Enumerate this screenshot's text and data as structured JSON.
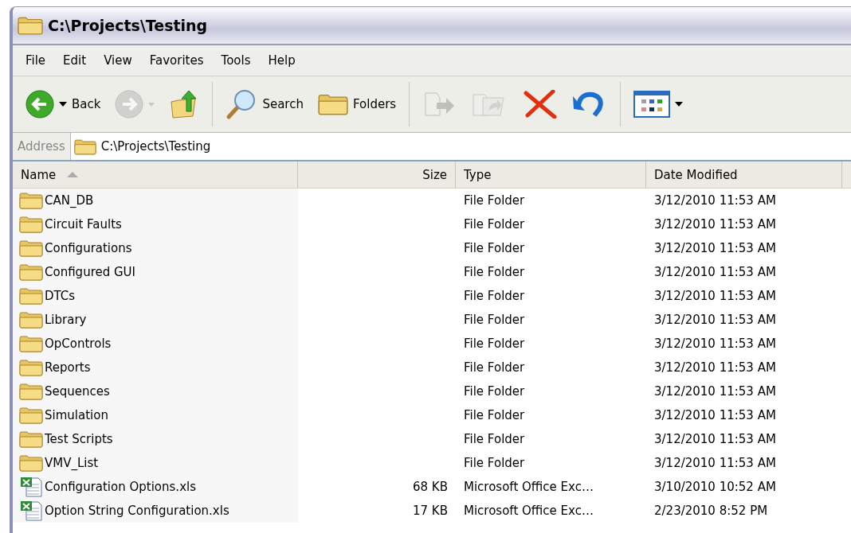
{
  "window": {
    "title": "C:\\Projects\\Testing"
  },
  "menu": [
    "File",
    "Edit",
    "View",
    "Favorites",
    "Tools",
    "Help"
  ],
  "toolbar": [
    {
      "kind": "back",
      "label": "Back",
      "disabled": false
    },
    {
      "kind": "forward",
      "disabled": true
    },
    {
      "kind": "up",
      "disabled": false
    },
    {
      "kind": "search",
      "label": "Search",
      "disabled": false
    },
    {
      "kind": "folders",
      "label": "Folders",
      "disabled": false
    },
    {
      "kind": "move",
      "disabled": true
    },
    {
      "kind": "copy",
      "disabled": true
    },
    {
      "kind": "delete",
      "disabled": false
    },
    {
      "kind": "undo",
      "disabled": false
    },
    {
      "kind": "views",
      "disabled": false
    }
  ],
  "address": {
    "label": "Address",
    "value": "C:\\Projects\\Testing"
  },
  "table": {
    "columns": [
      {
        "label": "Name",
        "sorted": true
      },
      {
        "label": "Size",
        "sorted": false
      },
      {
        "label": "Type",
        "sorted": false
      },
      {
        "label": "Date Modified",
        "sorted": false
      }
    ],
    "rows": [
      {
        "kind": "folder",
        "name": "CAN_DB",
        "type": "File Folder",
        "date": "3/12/2010 11:53 AM"
      },
      {
        "kind": "folder",
        "name": "Circuit Faults",
        "type": "File Folder",
        "date": "3/12/2010 11:53 AM"
      },
      {
        "kind": "folder",
        "name": "Configurations",
        "type": "File Folder",
        "date": "3/12/2010 11:53 AM"
      },
      {
        "kind": "folder",
        "name": "Configured GUI",
        "type": "File Folder",
        "date": "3/12/2010 11:53 AM"
      },
      {
        "kind": "folder",
        "name": "DTCs",
        "type": "File Folder",
        "date": "3/12/2010 11:53 AM"
      },
      {
        "kind": "folder",
        "name": "Library",
        "type": "File Folder",
        "date": "3/12/2010 11:53 AM"
      },
      {
        "kind": "folder",
        "name": "OpControls",
        "type": "File Folder",
        "date": "3/12/2010 11:53 AM"
      },
      {
        "kind": "folder",
        "name": "Reports",
        "type": "File Folder",
        "date": "3/12/2010 11:53 AM"
      },
      {
        "kind": "folder",
        "name": "Sequences",
        "type": "File Folder",
        "date": "3/12/2010 11:53 AM"
      },
      {
        "kind": "folder",
        "name": "Simulation",
        "type": "File Folder",
        "date": "3/12/2010 11:53 AM"
      },
      {
        "kind": "folder",
        "name": "Test Scripts",
        "type": "File Folder",
        "date": "3/12/2010 11:53 AM"
      },
      {
        "kind": "folder",
        "name": "VMV_List",
        "type": "File Folder",
        "date": "3/12/2010 11:53 AM"
      },
      {
        "kind": "excel",
        "name": "Configuration Options.xls",
        "size": "68 KB",
        "type": "Microsoft Office Exc…",
        "date": "3/10/2010 10:52 AM"
      },
      {
        "kind": "excel",
        "name": "Option String Configuration.xls",
        "size": "17 KB",
        "type": "Microsoft Office Exc…",
        "date": "2/23/2010 8:52 PM"
      }
    ]
  }
}
